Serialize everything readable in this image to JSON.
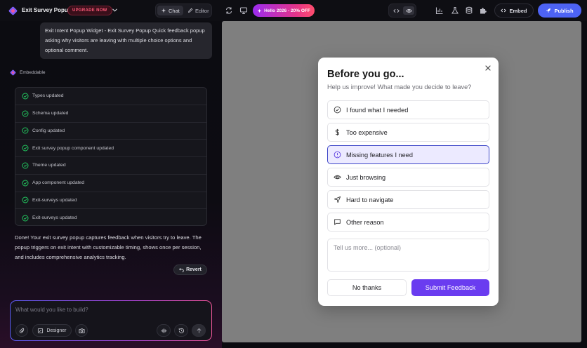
{
  "header": {
    "project_name": "Exit Survey Popup",
    "upgrade_label": "UPGRADE NOW",
    "tabs": [
      {
        "label": "Chat",
        "active": true
      },
      {
        "label": "Editor",
        "active": false
      }
    ],
    "promo_label": "Hello 2026 - 20% OFF",
    "embed_label": "Embed",
    "publish_label": "Publish",
    "icons": [
      "refresh-icon",
      "monitor-icon",
      "code-icon",
      "eye-icon",
      "chart-icon",
      "flask-icon",
      "database-icon",
      "puzzle-icon"
    ]
  },
  "chat": {
    "user_message": "Exit Intent Popup Widget - Exit Survey Popup Quick feedback popup asking why visitors are leaving with multiple choice options and optional comment.",
    "bot_name": "Embeddable",
    "steps": [
      "Types updated",
      "Schema updated",
      "Config updated",
      "Exit survey popup component updated",
      "Theme updated",
      "App component updated",
      "Exit-surveys updated",
      "Exit-surveys updated"
    ],
    "summary": "Done! Your exit survey popup captures feedback when visitors try to leave. The popup triggers on exit intent with customizable timing, shows once per session, and includes comprehensive analytics tracking.",
    "revert_label": "Revert",
    "composer": {
      "placeholder": "What would you like to build?",
      "designer_label": "Designer"
    }
  },
  "popup": {
    "title": "Before you go...",
    "subtitle": "Help us improve! What made you decide to leave?",
    "options": [
      {
        "label": "I found what I needed",
        "icon": "check-circle-icon",
        "selected": false
      },
      {
        "label": "Too expensive",
        "icon": "dollar-icon",
        "selected": false
      },
      {
        "label": "Missing features I need",
        "icon": "alert-circle-icon",
        "selected": true
      },
      {
        "label": "Just browsing",
        "icon": "eye-icon",
        "selected": false
      },
      {
        "label": "Hard to navigate",
        "icon": "navigation-icon",
        "selected": false
      },
      {
        "label": "Other reason",
        "icon": "message-square-icon",
        "selected": false
      }
    ],
    "comment_placeholder": "Tell us more... (optional)",
    "no_thanks_label": "No thanks",
    "submit_label": "Submit Feedback"
  },
  "colors": {
    "accent": "#4d63f5",
    "submit": "#6a3cf0",
    "selected_border": "#3f48c8",
    "selected_bg": "#eceaff",
    "success": "#22c55e",
    "upgrade": "#ff5b7a"
  }
}
